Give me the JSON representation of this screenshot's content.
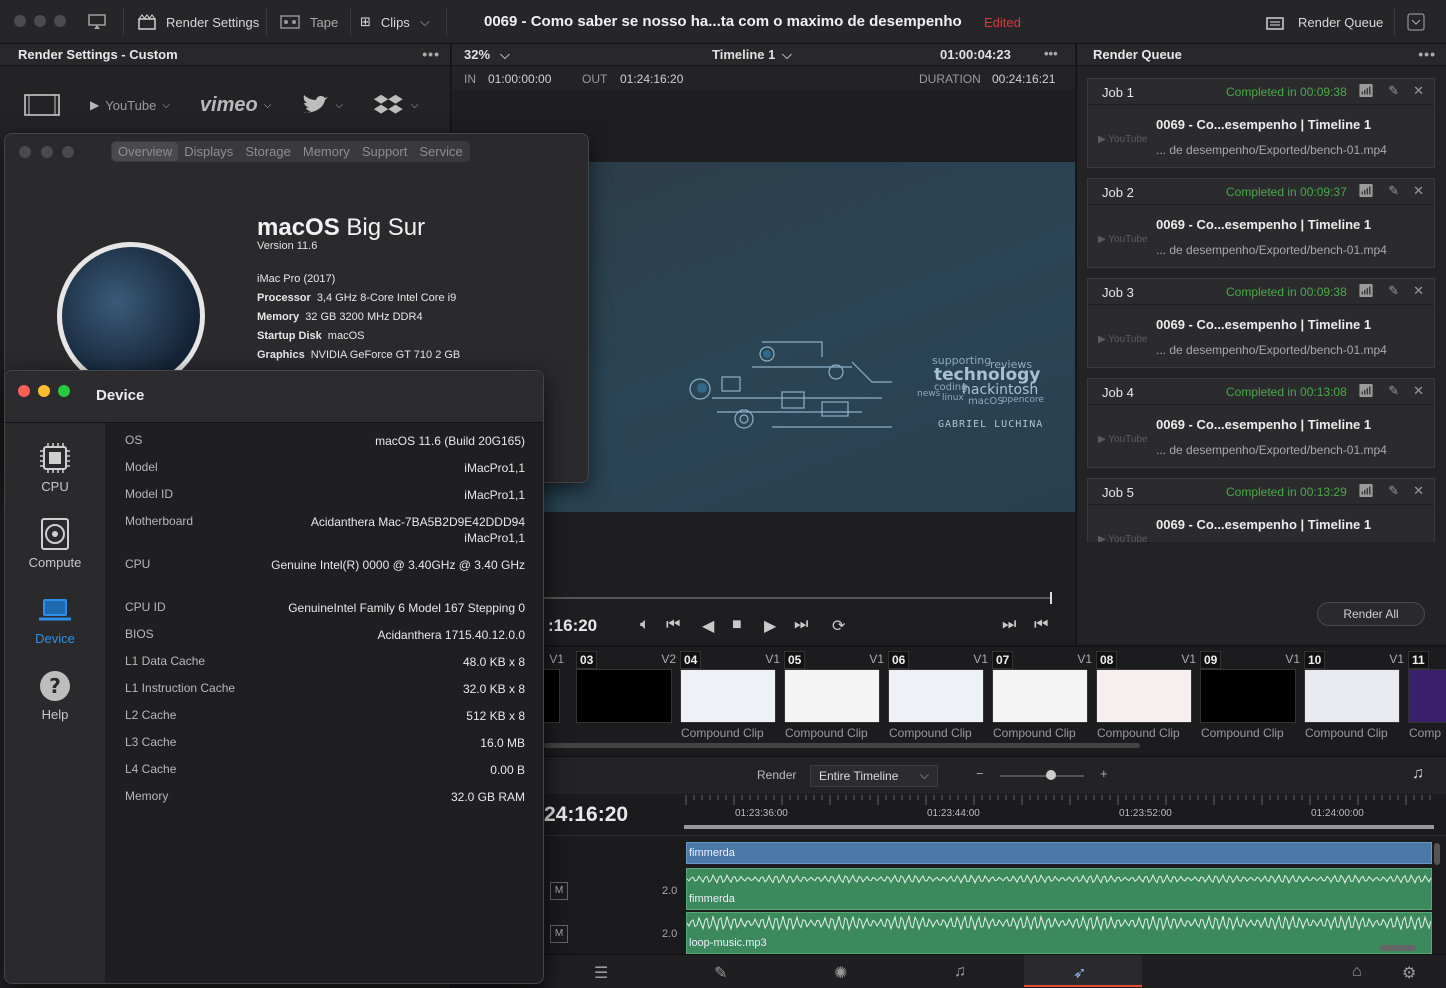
{
  "topbar": {
    "render_settings": "Render Settings",
    "tape": "Tape",
    "clips": "Clips",
    "project_title": "0069 - Como saber se nosso ha...ta com o maximo de desempenho",
    "edited": "Edited",
    "render_queue": "Render Queue"
  },
  "render_settings": {
    "header": "Render Settings - Custom",
    "presets": [
      "YouTube",
      "vimeo"
    ]
  },
  "viewer": {
    "zoom": "32%",
    "timeline": "Timeline 1",
    "timecode": "01:00:04:23",
    "in_label": "IN",
    "in_value": "01:00:00:00",
    "out_label": "OUT",
    "out_value": "01:24:16:20",
    "duration_label": "DURATION",
    "duration_value": "00:24:16:21",
    "current_time": ":16:20",
    "frame_words": [
      "supporting",
      "reviews",
      "technology",
      "coding",
      "hackintosh",
      "news",
      "linux",
      "macOS",
      "opencore",
      "GABRIEL LUCHINA"
    ]
  },
  "render_queue": {
    "header": "Render Queue",
    "jobs": [
      {
        "name": "Job 1",
        "status": "Completed in 00:09:38",
        "title": "0069 - Co...esempenho | Timeline 1",
        "path": "... de desempenho/Exported/bench-01.mp4"
      },
      {
        "name": "Job 2",
        "status": "Completed in 00:09:37",
        "title": "0069 - Co...esempenho | Timeline 1",
        "path": "... de desempenho/Exported/bench-01.mp4"
      },
      {
        "name": "Job 3",
        "status": "Completed in 00:09:38",
        "title": "0069 - Co...esempenho | Timeline 1",
        "path": "... de desempenho/Exported/bench-01.mp4"
      },
      {
        "name": "Job 4",
        "status": "Completed in 00:13:08",
        "title": "0069 - Co...esempenho | Timeline 1",
        "path": "... de desempenho/Exported/bench-01.mp4"
      },
      {
        "name": "Job 5",
        "status": "Completed in 00:13:29",
        "title": "0069 - Co...esempenho | Timeline 1",
        "path": ""
      }
    ],
    "youtube": "YouTube",
    "render_all": "Render All"
  },
  "clips": [
    {
      "num": "",
      "track": "V1",
      "label": "lip"
    },
    {
      "num": "03",
      "track": "V2",
      "label": ""
    },
    {
      "num": "04",
      "track": "V1",
      "label": "Compound Clip"
    },
    {
      "num": "05",
      "track": "V1",
      "label": "Compound Clip"
    },
    {
      "num": "06",
      "track": "V1",
      "label": "Compound Clip"
    },
    {
      "num": "07",
      "track": "V1",
      "label": "Compound Clip"
    },
    {
      "num": "08",
      "track": "V1",
      "label": "Compound Clip"
    },
    {
      "num": "09",
      "track": "V1",
      "label": "Compound Clip"
    },
    {
      "num": "10",
      "track": "V1",
      "label": "Compound Clip"
    },
    {
      "num": "11",
      "track": "",
      "label": "Comp"
    }
  ],
  "timeline": {
    "render_label": "Render",
    "render_option": "Entire Timeline",
    "timecode": "24:16:20",
    "ruler": [
      "01:23:36:00",
      "01:23:44:00",
      "01:23:52:00",
      "01:24:00:00"
    ],
    "video_clip": "fimmerda",
    "audio_tracks": [
      {
        "m": "M",
        "level": "2.0",
        "clip": "fimmerda"
      },
      {
        "m": "M",
        "level": "2.0",
        "clip": "loop-music.mp3"
      }
    ]
  },
  "about": {
    "tabs": [
      "Overview",
      "Displays",
      "Storage",
      "Memory",
      "Support",
      "Service"
    ],
    "os_bold": "macOS",
    "os_light": "Big Sur",
    "version": "Version 11.6",
    "machine": "iMac Pro (2017)",
    "specs": [
      {
        "k": "Processor",
        "v": "3,4 GHz 8-Core Intel Core i9"
      },
      {
        "k": "Memory",
        "v": "32 GB 3200 MHz DDR4"
      },
      {
        "k": "Startup Disk",
        "v": "macOS"
      },
      {
        "k": "Graphics",
        "v": "NVIDIA GeForce GT 710 2 GB"
      }
    ]
  },
  "device": {
    "title": "Device",
    "sidebar": [
      "CPU",
      "Compute",
      "Device",
      "Help"
    ],
    "rows": [
      {
        "k": "OS",
        "v": "macOS 11.6 (Build 20G165)"
      },
      {
        "k": "Model",
        "v": "iMacPro1,1"
      },
      {
        "k": "Model ID",
        "v": "iMacPro1,1"
      },
      {
        "k": "Motherboard",
        "v": "Acidanthera Mac-7BA5B2D9E42DDD94 iMacPro1,1"
      },
      {
        "k": "CPU",
        "v": "Genuine Intel(R) 0000 @ 3.40GHz @ 3.40 GHz"
      },
      {
        "k": "CPU ID",
        "v": "GenuineIntel Family 6 Model 167 Stepping 0"
      },
      {
        "k": "BIOS",
        "v": "Acidanthera 1715.40.12.0.0"
      },
      {
        "k": "L1 Data Cache",
        "v": "48.0 KB x 8"
      },
      {
        "k": "L1 Instruction Cache",
        "v": "32.0 KB x 8"
      },
      {
        "k": "L2 Cache",
        "v": "512 KB x 8"
      },
      {
        "k": "L3 Cache",
        "v": "16.0 MB"
      },
      {
        "k": "L4 Cache",
        "v": "0.00 B"
      },
      {
        "k": "Memory",
        "v": "32.0 GB RAM"
      }
    ]
  }
}
